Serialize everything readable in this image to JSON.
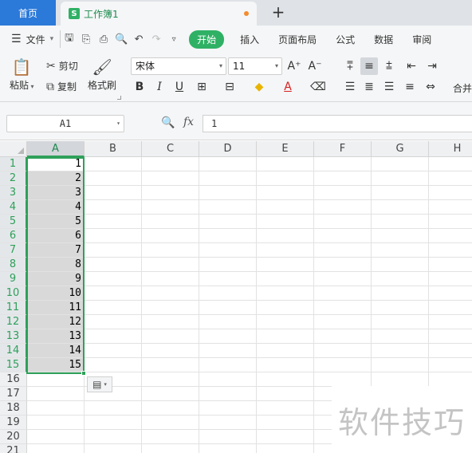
{
  "tabs": {
    "home": "首页",
    "doc_icon": "S",
    "doc_title": "工作簿1",
    "add": "+"
  },
  "menu": {
    "file": "文件",
    "ribbon_tabs": [
      "开始",
      "插入",
      "页面布局",
      "公式",
      "数据",
      "审阅"
    ]
  },
  "ribbon": {
    "paste": "粘贴",
    "cut": "剪切",
    "copy": "复制",
    "format_painter": "格式刷",
    "font_name": "宋体",
    "font_size": "11",
    "merge": "合并"
  },
  "formula_bar": {
    "name_box": "A1",
    "fx": "fx",
    "value": "1"
  },
  "sheet": {
    "columns": [
      "A",
      "B",
      "C",
      "D",
      "E",
      "F",
      "G",
      "H"
    ],
    "rows": [
      "1",
      "2",
      "3",
      "4",
      "5",
      "6",
      "7",
      "8",
      "9",
      "10",
      "11",
      "12",
      "13",
      "14",
      "15",
      "16",
      "17",
      "18",
      "19",
      "20",
      "21"
    ],
    "column_a_values": [
      "1",
      "2",
      "3",
      "4",
      "5",
      "6",
      "7",
      "8",
      "9",
      "10",
      "11",
      "12",
      "13",
      "14",
      "15"
    ],
    "selected_range": "A1:A15"
  },
  "watermark": "软件技巧",
  "colors": {
    "accent_green": "#2fb165",
    "home_tab_blue": "#2b79d9",
    "selection_green": "#2fa05a"
  }
}
